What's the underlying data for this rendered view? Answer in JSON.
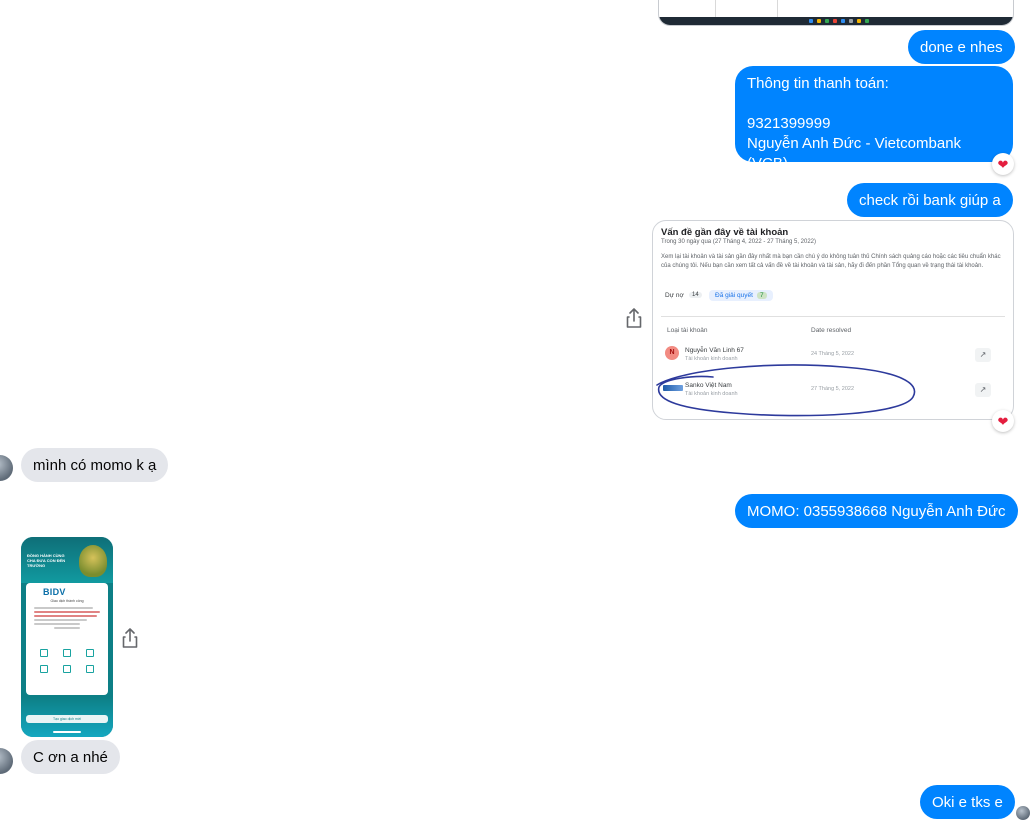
{
  "messages_out": {
    "m1": "done e nhes",
    "m2_line1": "Thông tin thanh toán:",
    "m2_line2": "9321399999",
    "m2_line3": "Nguyễn Anh Đức - Vietcombank (VCB)",
    "m3": "check rồi bank giúp a",
    "m4": "MOMO: 0355938668 Nguyễn Anh Đức",
    "m5": "Oki e tks e"
  },
  "messages_in": {
    "m1": "mình có momo k ạ",
    "m2": "C ơn a nhé"
  },
  "reactions": {
    "heart": "❤"
  },
  "icons": {
    "share": "share-icon"
  },
  "shot_account": {
    "title": "Vấn đề gần đây về tài khoản",
    "subtitle": "Trong 30 ngày qua (27 Tháng 4, 2022 - 27 Tháng 5, 2022)",
    "desc": "Xem lại tài khoản và tài sản gần đây nhất mà bạn cần chú ý do không tuân thủ Chính sách quảng cáo hoặc các tiêu chuẩn khác của chúng tôi. Nếu bạn cần xem tất cả vấn đề về tài khoản và tài sản, hãy đi đến phần Tổng quan về trạng thái tài khoản.",
    "tab_pending": "Dự nợ",
    "tab_pending_count": "14",
    "tab_resolved": "Đã giải quyết",
    "tab_resolved_count": "7",
    "col_account": "Loại tài khoản",
    "col_date": "Date resolved",
    "rows": [
      {
        "avatar": "N",
        "name": "Nguyễn Văn Linh 67",
        "sub": "Tài khoản kinh doanh",
        "date": "24 Tháng 5, 2022"
      },
      {
        "avatar": "",
        "name": "Sanko Việt Nam",
        "sub": "Tài khoản kinh doanh",
        "date": "27 Tháng 5, 2022"
      }
    ]
  },
  "shot_phone": {
    "banner": "ĐỒNG HÀNH CÙNG CHA ĐƯA CON ĐẾN TRƯỜNG",
    "brand": "BIDV",
    "brand_sub": "Giao dịch thành công",
    "button": "Tạo giao dịch mới"
  },
  "colors": {
    "outgoing": "#0084ff",
    "incoming": "#e4e6eb",
    "heart": "#e41e3f",
    "annotation": "#2d3a9c"
  }
}
